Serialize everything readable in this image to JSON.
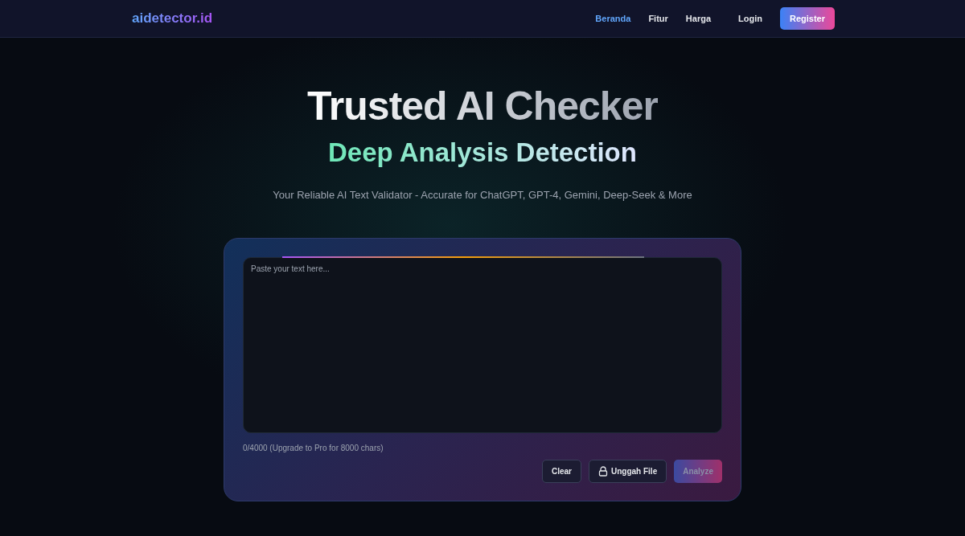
{
  "nav": {
    "logo": "aidetector.id",
    "links": [
      {
        "label": "Beranda",
        "selected": true
      },
      {
        "label": "Fitur",
        "selected": false
      },
      {
        "label": "Harga",
        "selected": false
      }
    ],
    "login": "Login",
    "register": "Register"
  },
  "hero": {
    "title": "Trusted AI Checker",
    "subtitle": "Deep Analysis Detection",
    "tagline": "Your Reliable AI Text Validator - Accurate for ChatGPT, GPT-4, Gemini, Deep-Seek & More"
  },
  "checker": {
    "placeholder": "Paste your text here...",
    "counter": "0/4000 (Upgrade to Pro for 8000 chars)",
    "buttons": [
      {
        "label": "Clear",
        "kind": "plain",
        "disabled": false
      },
      {
        "label": "Unggah File",
        "kind": "locked",
        "disabled": false
      },
      {
        "label": "Analyze",
        "kind": "primary",
        "disabled": true
      }
    ]
  }
}
